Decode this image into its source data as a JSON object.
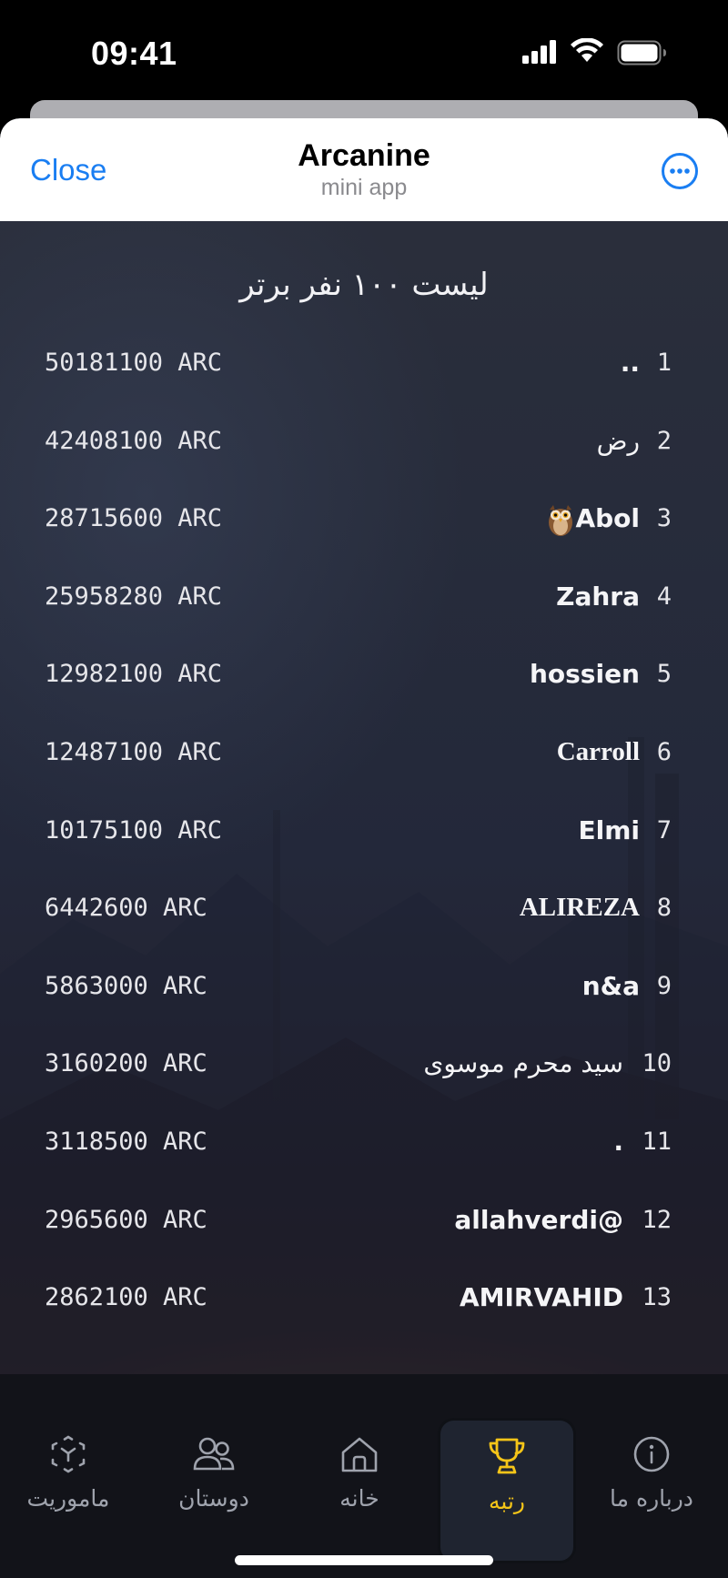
{
  "status_bar": {
    "time": "09:41"
  },
  "header": {
    "close_label": "Close",
    "title": "Arcanine",
    "subtitle": "mini app"
  },
  "leaderboard": {
    "title": "لیست ۱۰۰ نفر برتر",
    "rows": [
      {
        "rank": "1",
        "name": "..",
        "score": "50181100 ARC"
      },
      {
        "rank": "2",
        "name": "رض",
        "score": "42408100 ARC"
      },
      {
        "rank": "3",
        "name": "Abol",
        "score": "28715600 ARC"
      },
      {
        "rank": "4",
        "name": "Zahra",
        "score": "25958280 ARC"
      },
      {
        "rank": "5",
        "name": "hossien",
        "score": "12982100 ARC"
      },
      {
        "rank": "6",
        "name": "Carroll",
        "score": "12487100 ARC"
      },
      {
        "rank": "7",
        "name": "Elmi",
        "score": "10175100 ARC"
      },
      {
        "rank": "8",
        "name": "ALIREZA",
        "score": "6442600 ARC"
      },
      {
        "rank": "9",
        "name": "n&a",
        "score": "5863000 ARC"
      },
      {
        "rank": "10",
        "name": "سید محرم موسوی",
        "score": "3160200 ARC"
      },
      {
        "rank": "11",
        "name": ".",
        "score": "3118500 ARC"
      },
      {
        "rank": "12",
        "name": "allahverdi@",
        "score": "2965600 ARC"
      },
      {
        "rank": "13",
        "name": "AMIRVAHID",
        "score": "2862100 ARC"
      }
    ]
  },
  "tabs": [
    {
      "label": "ماموریت",
      "icon": "mission-icon"
    },
    {
      "label": "دوستان",
      "icon": "friends-icon"
    },
    {
      "label": "خانه",
      "icon": "home-icon"
    },
    {
      "label": "رتبه",
      "icon": "trophy-icon"
    },
    {
      "label": "درباره ما",
      "icon": "info-icon"
    }
  ],
  "colors": {
    "accent": "#1a7ef2",
    "active_tab": "#f5c518"
  }
}
